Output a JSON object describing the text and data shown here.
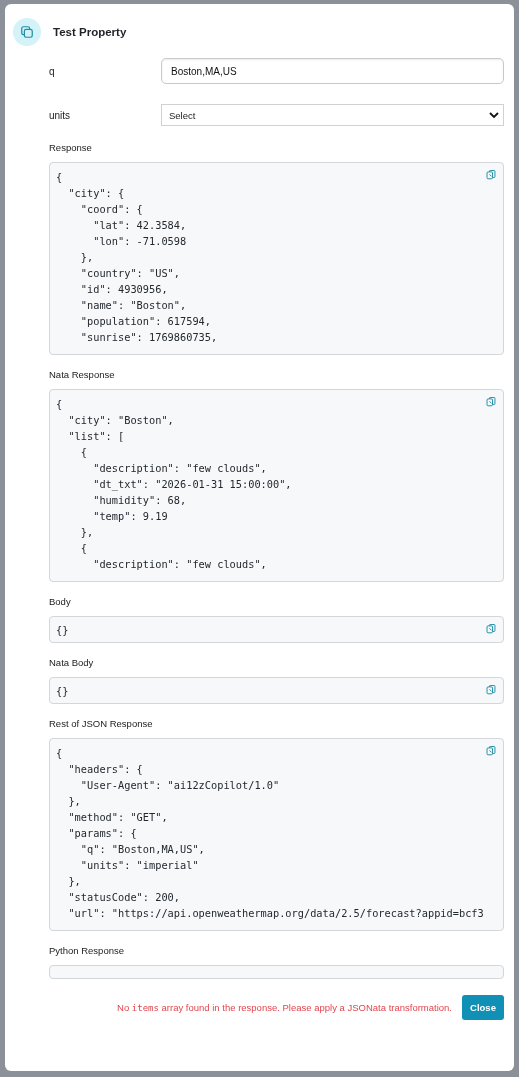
{
  "dialog": {
    "title": "Test Property"
  },
  "params": [
    {
      "label": "q",
      "kind": "text",
      "value": "Boston,MA,US"
    },
    {
      "label": "units",
      "kind": "select",
      "value": "Select"
    }
  ],
  "sections": [
    {
      "label": "Response",
      "kind": "tall",
      "lines": [
        "{",
        "  \"city\": {",
        "    \"coord\": {",
        "      \"lat\": 42.3584,",
        "      \"lon\": -71.0598",
        "    },",
        "    \"country\": \"US\",",
        "    \"id\": 4930956,",
        "    \"name\": \"Boston\",",
        "    \"population\": 617594,",
        "    \"sunrise\": 1769860735,"
      ]
    },
    {
      "label": "Nata Response",
      "kind": "tall",
      "lines": [
        "{",
        "  \"city\": \"Boston\",",
        "  \"list\": [",
        "    {",
        "      \"description\": \"few clouds\",",
        "      \"dt_txt\": \"2026-01-31 15:00:00\",",
        "      \"humidity\": 68,",
        "      \"temp\": 9.19",
        "    },",
        "    {",
        "      \"description\": \"few clouds\","
      ]
    },
    {
      "label": "Body",
      "kind": "short",
      "lines": [
        "{}"
      ]
    },
    {
      "label": "Nata Body",
      "kind": "short",
      "lines": [
        "{}"
      ]
    },
    {
      "label": "Rest of JSON Response",
      "kind": "tall",
      "lines": [
        "{",
        "  \"headers\": {",
        "    \"User-Agent\": \"ai12zCopilot/1.0\"",
        "  },",
        "  \"method\": \"GET\",",
        "  \"params\": {",
        "    \"q\": \"Boston,MA,US\",",
        "    \"units\": \"imperial\"",
        "  },",
        "  \"statusCode\": 200,",
        "  \"url\": \"https://api.openweathermap.org/data/2.5/forecast?appid=bcf3"
      ]
    },
    {
      "label": "Python Response",
      "kind": "empty"
    }
  ],
  "footer": {
    "message": [
      {
        "kind": "text",
        "text": "No "
      },
      {
        "kind": "code",
        "text": "items"
      },
      {
        "kind": "text",
        "text": " array found in the response. Please apply a JSONata transformation."
      }
    ],
    "buttons": [
      "Close"
    ]
  }
}
